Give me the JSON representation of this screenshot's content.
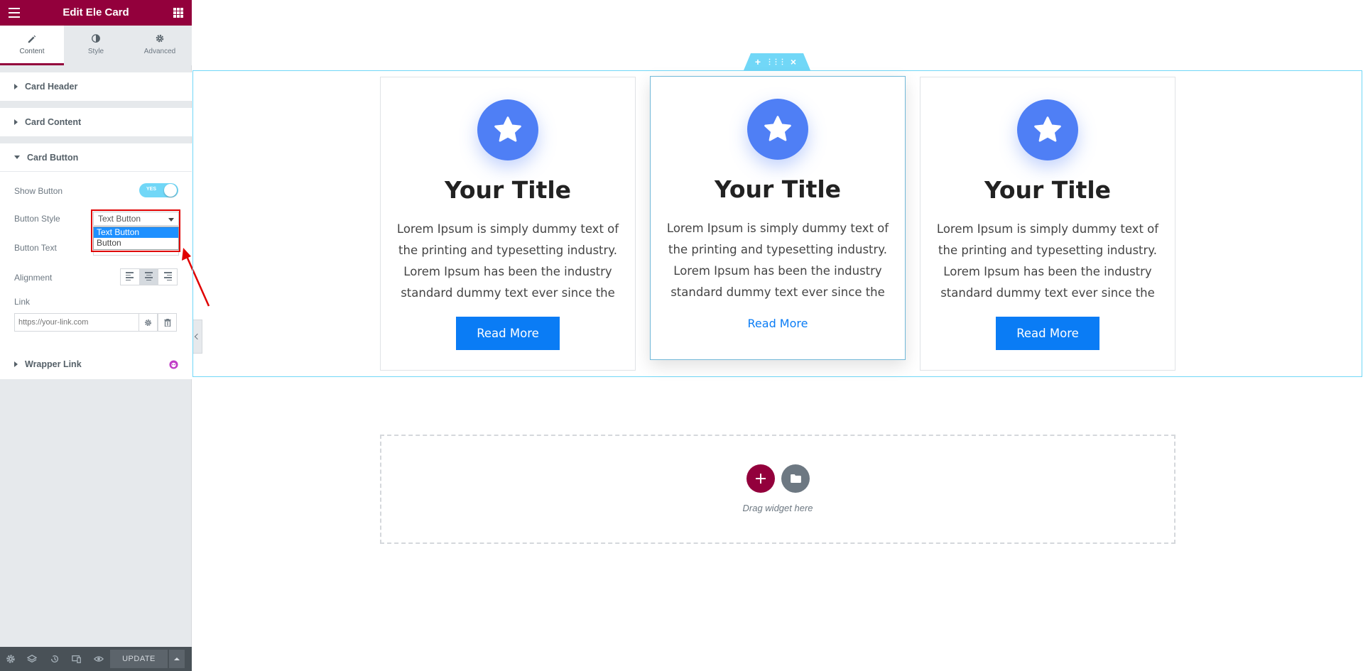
{
  "editor": {
    "title": "Edit Ele Card",
    "tabs": [
      {
        "label": "Content",
        "active": true
      },
      {
        "label": "Style",
        "active": false
      },
      {
        "label": "Advanced",
        "active": false
      }
    ],
    "sections": {
      "card_header": "Card Header",
      "card_content": "Card Content",
      "card_button": "Card Button",
      "wrapper_link": "Wrapper Link"
    },
    "controls": {
      "show_button_label": "Show Button",
      "show_button_toggle": "YES",
      "button_style_label": "Button Style",
      "button_style_value": "Text Button",
      "button_style_options": [
        "Text Button",
        "Button"
      ],
      "button_text_label": "Button Text",
      "alignment_label": "Alignment",
      "link_label": "Link",
      "link_placeholder": "https://your-link.com"
    },
    "footer": {
      "update_label": "UPDATE"
    },
    "accent_color": "#93003c"
  },
  "canvas": {
    "cards": [
      {
        "title": "Your Title",
        "text": "Lorem Ipsum is simply dummy text of the printing and typesetting industry. Lorem Ipsum has been the industry standard dummy text ever since the",
        "button": "Read More",
        "style": "button"
      },
      {
        "title": "Your Title",
        "text": "Lorem Ipsum is simply dummy text of the printing and typesetting industry. Lorem Ipsum has been the industry standard dummy text ever since the",
        "button": "Read More",
        "style": "text"
      },
      {
        "title": "Your Title",
        "text": "Lorem Ipsum is simply dummy text of the printing and typesetting industry. Lorem Ipsum has been the industry standard dummy text ever since the",
        "button": "Read More",
        "style": "button"
      }
    ],
    "drop_zone_text": "Drag widget here",
    "card_icon": "star-icon",
    "primary_color": "#0a7cf5",
    "icon_color": "#4f7ff5"
  }
}
